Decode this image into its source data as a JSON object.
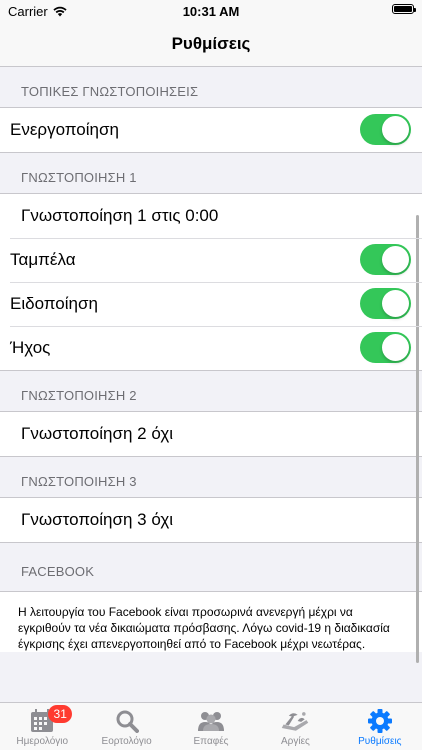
{
  "status_bar": {
    "carrier": "Carrier",
    "time": "10:31 AM",
    "battery_level": 1.0
  },
  "nav": {
    "title": "Ρυθμίσεις"
  },
  "sections": {
    "local": {
      "header": "ΤΟΠΙΚΕΣ ΓΝΩΣΤΟΠΟΙΗΣΕΙΣ",
      "enable": {
        "label": "Ενεργοποίηση",
        "on": true
      }
    },
    "n1": {
      "header": "ΓΝΩΣΤΟΠΟΙΗΣΗ 1",
      "summary": "Γνωστοποίηση 1 στις 0:00",
      "badge": {
        "label": "Ταμπέλα",
        "on": true
      },
      "alert": {
        "label": "Ειδοποίηση",
        "on": true
      },
      "sound": {
        "label": "Ήχος",
        "on": true
      }
    },
    "n2": {
      "header": "ΓΝΩΣΤΟΠΟΙΗΣΗ 2",
      "summary": "Γνωστοποίηση 2 όχι"
    },
    "n3": {
      "header": "ΓΝΩΣΤΟΠΟΙΗΣΗ 3",
      "summary": "Γνωστοποίηση 3 όχι"
    },
    "facebook": {
      "header": "FACEBOOK",
      "info": "Η λειτουργία του Facebook είναι προσωρινά ανενεργή μέχρι να εγκριθούν τα νέα δικαιώματα πρόσβασης. Λόγω covid-19 η διαδικασία έγκρισης έχει απενεργοποιηθεί από το Facebook μέχρι νεωτέρας."
    }
  },
  "tabs": [
    {
      "label": "Ημερολόγιο",
      "icon": "calendar-icon",
      "badge": "31"
    },
    {
      "label": "Εορτολόγιο",
      "icon": "search-icon"
    },
    {
      "label": "Επαφές",
      "icon": "contacts-icon"
    },
    {
      "label": "Αργίες",
      "icon": "holiday-icon"
    },
    {
      "label": "Ρυθμίσεις",
      "icon": "gear-icon",
      "active": true
    }
  ],
  "colors": {
    "accent": "#0a7aff",
    "switch_on": "#34c759",
    "badge": "#ff3b30",
    "inactive_tab": "#8e8e93"
  }
}
